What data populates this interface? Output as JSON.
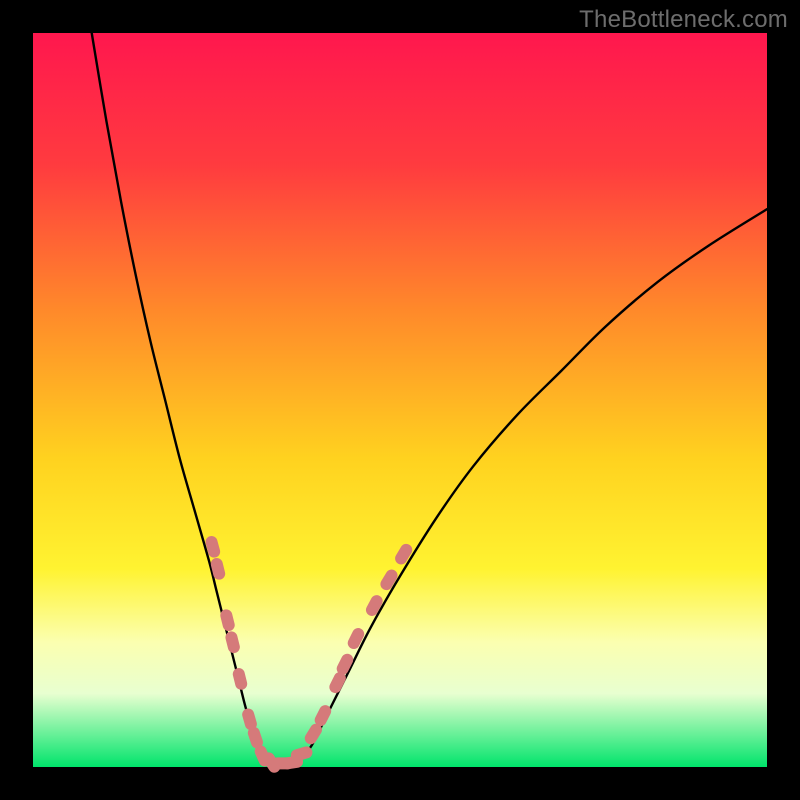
{
  "watermark": "TheBottleneck.com",
  "colors": {
    "gradient_stops": [
      {
        "pct": 0,
        "color": "#ff174e"
      },
      {
        "pct": 18,
        "color": "#ff3b3f"
      },
      {
        "pct": 38,
        "color": "#ff8a2a"
      },
      {
        "pct": 58,
        "color": "#ffd21f"
      },
      {
        "pct": 73,
        "color": "#fff331"
      },
      {
        "pct": 83,
        "color": "#fbffb0"
      },
      {
        "pct": 90,
        "color": "#e8ffd0"
      },
      {
        "pct": 100,
        "color": "#00e46b"
      }
    ],
    "curve": "#000000",
    "marker_fill": "#d57a7a",
    "marker_stroke": "#b85e5e",
    "frame": "#000000"
  },
  "chart_data": {
    "type": "line",
    "title": "",
    "xlabel": "",
    "ylabel": "",
    "xlim": [
      0,
      100
    ],
    "ylim": [
      0,
      100
    ],
    "series": [
      {
        "name": "left-branch",
        "x": [
          8,
          10,
          12,
          14,
          16,
          18,
          20,
          22,
          24,
          25,
          26,
          27,
          28,
          29,
          30,
          31,
          32
        ],
        "y": [
          100,
          88,
          77,
          67,
          58,
          50,
          42,
          35,
          28,
          24,
          20,
          16,
          12,
          8,
          5,
          2,
          0.5
        ]
      },
      {
        "name": "valley",
        "x": [
          32,
          33,
          34,
          35,
          36
        ],
        "y": [
          0.5,
          0.2,
          0.2,
          0.2,
          0.5
        ]
      },
      {
        "name": "right-branch",
        "x": [
          36,
          38,
          40,
          43,
          46,
          50,
          55,
          60,
          66,
          72,
          78,
          85,
          92,
          100
        ],
        "y": [
          0.5,
          3,
          7,
          13,
          19,
          26,
          34,
          41,
          48,
          54,
          60,
          66,
          71,
          76
        ]
      }
    ],
    "markers": [
      {
        "branch": "left",
        "x": 24.5,
        "y": 30
      },
      {
        "branch": "left",
        "x": 25.2,
        "y": 27
      },
      {
        "branch": "left",
        "x": 26.5,
        "y": 20
      },
      {
        "branch": "left",
        "x": 27.2,
        "y": 17
      },
      {
        "branch": "left",
        "x": 28.2,
        "y": 12
      },
      {
        "branch": "left",
        "x": 29.5,
        "y": 6.5
      },
      {
        "branch": "left",
        "x": 30.3,
        "y": 4.0
      },
      {
        "branch": "valley",
        "x": 31.3,
        "y": 1.5
      },
      {
        "branch": "valley",
        "x": 32.5,
        "y": 0.6
      },
      {
        "branch": "valley",
        "x": 34.0,
        "y": 0.5
      },
      {
        "branch": "valley",
        "x": 35.3,
        "y": 0.6
      },
      {
        "branch": "right",
        "x": 36.6,
        "y": 1.8
      },
      {
        "branch": "right",
        "x": 38.2,
        "y": 4.5
      },
      {
        "branch": "right",
        "x": 39.5,
        "y": 7.0
      },
      {
        "branch": "right",
        "x": 41.5,
        "y": 11.5
      },
      {
        "branch": "right",
        "x": 42.5,
        "y": 14.0
      },
      {
        "branch": "right",
        "x": 44.0,
        "y": 17.5
      },
      {
        "branch": "right",
        "x": 46.5,
        "y": 22.0
      },
      {
        "branch": "right",
        "x": 48.5,
        "y": 25.5
      },
      {
        "branch": "right",
        "x": 50.5,
        "y": 29.0
      }
    ]
  }
}
